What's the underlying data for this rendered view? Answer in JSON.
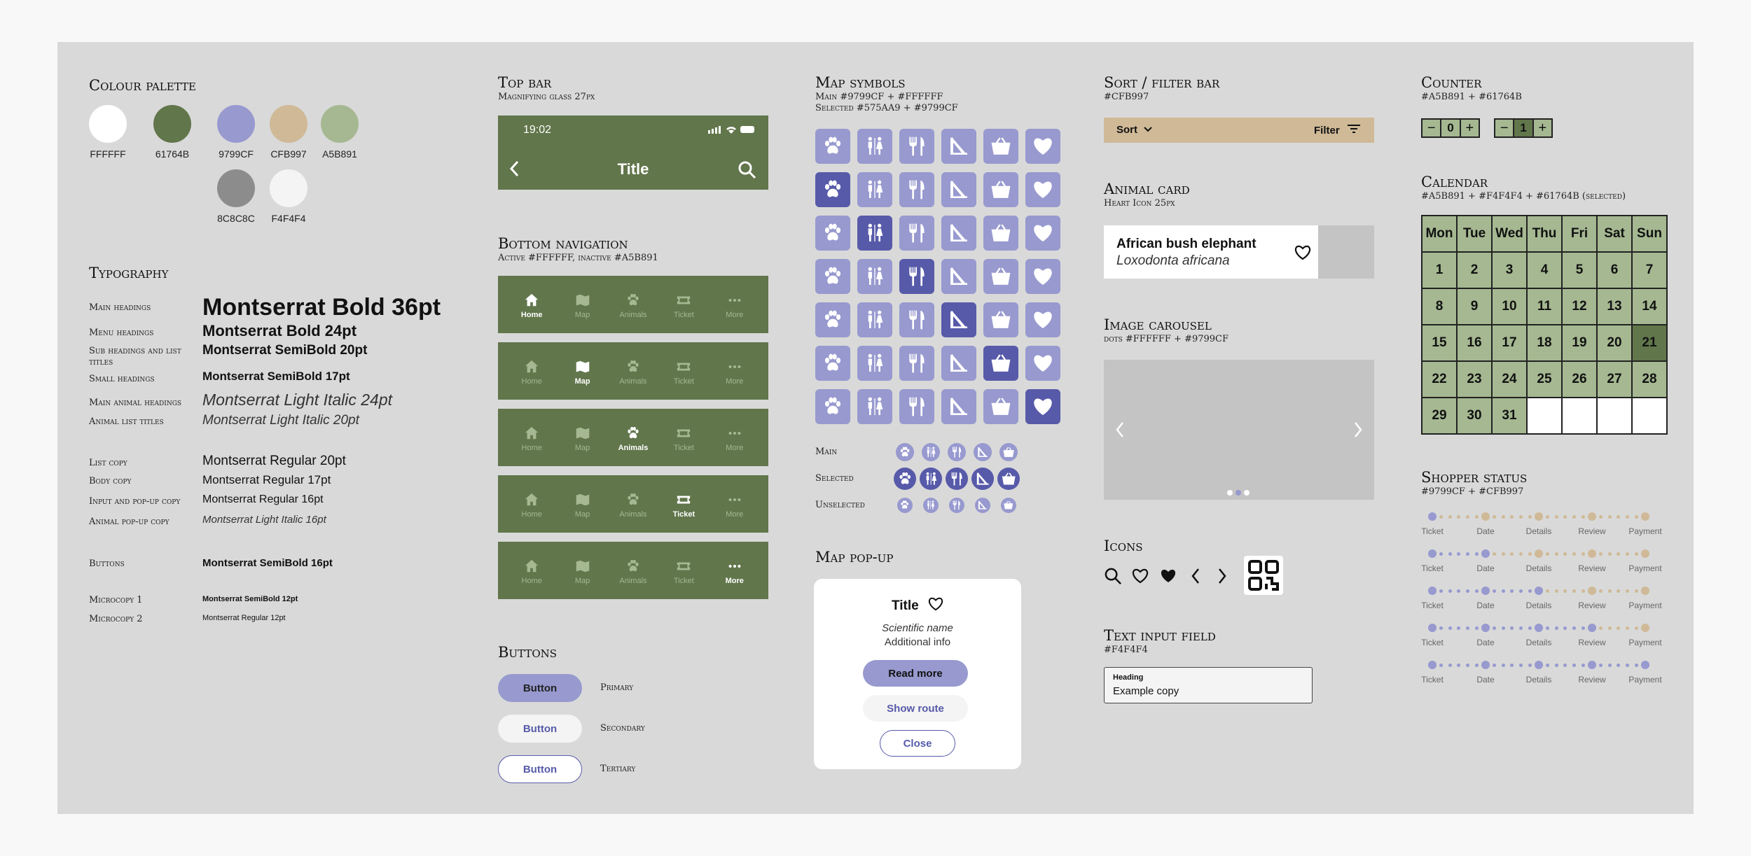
{
  "palette": {
    "title": "Colour palette",
    "swatches": [
      {
        "hex": "FFFFFF",
        "color": "#FFFFFF"
      },
      {
        "hex": "61764B",
        "color": "#61764B"
      },
      {
        "hex": "9799CF",
        "color": "#9799CF"
      },
      {
        "hex": "CFB997",
        "color": "#CFB997"
      },
      {
        "hex": "A5B891",
        "color": "#A5B891"
      },
      {
        "hex": "8C8C8C",
        "color": "#8C8C8C"
      },
      {
        "hex": "F4F4F4",
        "color": "#F4F4F4"
      }
    ]
  },
  "typography": {
    "title": "Typography",
    "rows": [
      {
        "label": "Main headings",
        "sample": "Montserrat Bold 36pt"
      },
      {
        "label": "Menu headings",
        "sample": "Montserrat Bold 24pt"
      },
      {
        "label": "Sub headings and list titles",
        "sample": "Montserrat SemiBold 20pt"
      },
      {
        "label": "Small headings",
        "sample": "Montserrat SemiBold 17pt"
      },
      {
        "label": "Main animal headings",
        "sample": "Montserrat Light Italic 24pt"
      },
      {
        "label": "Animal list titles",
        "sample": "Montserrat Light Italic 20pt"
      },
      {
        "label": "List copy",
        "sample": "Montserrat Regular 20pt"
      },
      {
        "label": "Body copy",
        "sample": "Montserrat Regular 17pt"
      },
      {
        "label": "Input and pop-up copy",
        "sample": "Montserrat Regular 16pt"
      },
      {
        "label": "Animal pop-up copy",
        "sample": "Montserrat Light Italic 16pt"
      },
      {
        "label": "Buttons",
        "sample": "Montserrat SemiBold 16pt"
      },
      {
        "label": "Microcopy 1",
        "sample": "Montserrat SemiBold 12pt"
      },
      {
        "label": "Microcopy 2",
        "sample": "Montserrat Regular 12pt"
      }
    ]
  },
  "topbar": {
    "title": "Top bar",
    "sub": "Magnifying glass 27px",
    "time": "19:02",
    "screen_title": "Title"
  },
  "bottomnav": {
    "title": "Bottom navigation",
    "sub": "Active #FFFFFF, inactive #A5B891",
    "items": [
      "Home",
      "Map",
      "Animals",
      "Ticket",
      "More"
    ]
  },
  "buttons": {
    "title": "Buttons",
    "label": "Button",
    "types": [
      "Primary",
      "Secondary",
      "Tertiary"
    ]
  },
  "mapsymbols": {
    "title": "Map symbols",
    "sub1": "Main #9799CF + #FFFFFF",
    "sub2": "Selected #575AA9 + #9799CF",
    "rows": [
      "Main",
      "Selected",
      "Unselected"
    ]
  },
  "mappopup": {
    "title": "Map pop-up",
    "card_title": "Title",
    "scientific": "Scientific name",
    "info": "Additional info",
    "read_more": "Read more",
    "show_route": "Show route",
    "close": "Close"
  },
  "sortbar": {
    "title": "Sort / filter bar",
    "sub": "#CFB997",
    "sort": "Sort",
    "filter": "Filter"
  },
  "animalcard": {
    "title": "Animal card",
    "sub": "Heart Icon 25px",
    "name": "African bush elephant",
    "latin": "Loxodonta africana"
  },
  "carousel": {
    "title": "Image carousel",
    "sub": "dots #FFFFFF + #9799CF"
  },
  "icons": {
    "title": "Icons"
  },
  "textinput": {
    "title": "Text input field",
    "sub": "#F4F4F4",
    "heading": "Heading",
    "value": "Example copy"
  },
  "counter": {
    "title": "Counter",
    "sub": "#A5B891 + #61764B",
    "value1": "0",
    "value2": "1"
  },
  "calendar": {
    "title": "Calendar",
    "sub": "#A5B891 + #F4F4F4 + #61764B (selected)",
    "days": [
      "Mon",
      "Tue",
      "Wed",
      "Thu",
      "Fri",
      "Sat",
      "Sun"
    ],
    "dates": [
      "1",
      "2",
      "3",
      "4",
      "5",
      "6",
      "7",
      "8",
      "9",
      "10",
      "11",
      "12",
      "13",
      "14",
      "15",
      "16",
      "17",
      "18",
      "19",
      "20",
      "21",
      "22",
      "23",
      "24",
      "25",
      "26",
      "27",
      "28",
      "29",
      "30",
      "31"
    ],
    "selected": "21"
  },
  "shopper": {
    "title": "Shopper status",
    "sub": "#9799CF + #CFB997",
    "steps": [
      "Ticket",
      "Date",
      "Details",
      "Review",
      "Payment"
    ],
    "active_steps": [
      1,
      2,
      3,
      4,
      5
    ]
  }
}
